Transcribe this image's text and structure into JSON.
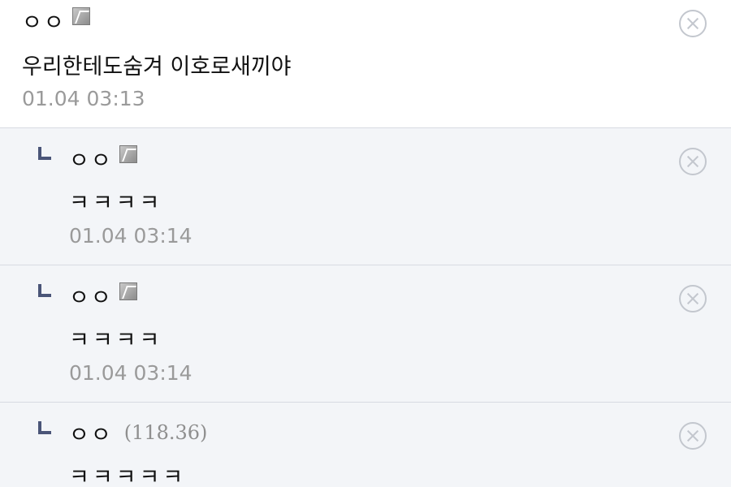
{
  "comments": [
    {
      "nickname": "ㅇㅇ",
      "badge_icon": "fixed-nick-icon",
      "ip": "",
      "text": "우리한테도숨겨 이호로새끼야",
      "date": "01.04 03:13"
    }
  ],
  "replies": [
    {
      "nickname": "ㅇㅇ",
      "badge_icon": "fixed-nick-icon",
      "ip": "",
      "text": "ㅋㅋㅋㅋ",
      "date": "01.04 03:14"
    },
    {
      "nickname": "ㅇㅇ",
      "badge_icon": "fixed-nick-icon",
      "ip": "",
      "text": "ㅋㅋㅋㅋ",
      "date": "01.04 03:14"
    },
    {
      "nickname": "ㅇㅇ",
      "badge_icon": "",
      "ip": "(118.36)",
      "text": "ㅋㅋㅋㅋㅋ",
      "date": ""
    }
  ],
  "colors": {
    "reply_background": "#f3f5f8",
    "divider": "#d7dbe2",
    "reply_arrow": "#4a5578",
    "date_text": "#9a9a9a",
    "delete_icon": "#c3c7ce"
  }
}
